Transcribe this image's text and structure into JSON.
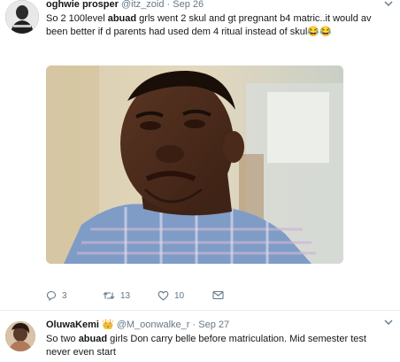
{
  "tweets": [
    {
      "name": "oghwie prosper",
      "handle": "@itz_zoid",
      "date": "Sep 26",
      "text_pre": "So 2 100level ",
      "text_bold": "abuad",
      "text_post": " grls went 2 skul and gt pregnant b4 matric..it would av been better if d parents had used dem 4 ritual instead of skul😂😂",
      "replies": "3",
      "retweets": "13",
      "likes": "10"
    },
    {
      "name": "OluwaKemi",
      "name_emoji": "👑",
      "handle": "@M_oonwalke_r",
      "date": "Sep 27",
      "text_pre": "So two ",
      "text_bold": "abuad",
      "text_post": " girls Don carry belle before matriculation. Mid semester test never even start"
    }
  ],
  "separator": "·",
  "icons": {
    "caret": "chevron-down-icon",
    "reply": "reply-icon",
    "retweet": "retweet-icon",
    "like": "heart-icon",
    "message": "envelope-icon"
  },
  "colors": {
    "text": "#14171a",
    "muted": "#657786",
    "divider": "#e6ecf0"
  }
}
